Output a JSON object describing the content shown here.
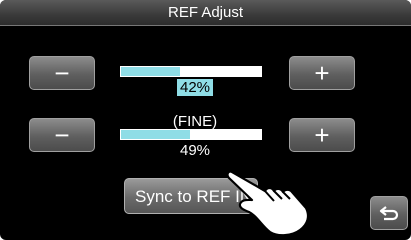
{
  "window": {
    "title": "REF Adjust"
  },
  "coarse": {
    "minus_label": "−",
    "plus_label": "+",
    "value_text": "42%",
    "level_percent": 42
  },
  "fine": {
    "label": "(FINE)",
    "minus_label": "−",
    "plus_label": "+",
    "value_text": "49%",
    "level_percent": 49
  },
  "sync_button": {
    "label": "Sync to REF IN"
  },
  "back_button": {
    "icon": "return-arrow-icon"
  },
  "colors": {
    "background": "#000000",
    "bar_fill": "#8fdde6",
    "button_gray": "#6a6a6a"
  }
}
